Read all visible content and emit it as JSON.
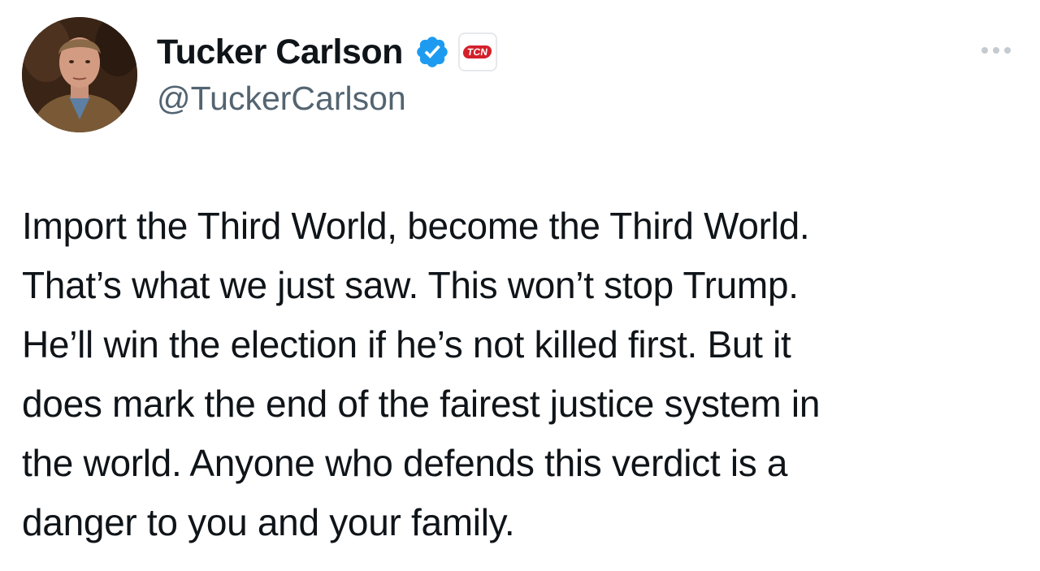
{
  "author": {
    "display_name": "Tucker Carlson",
    "handle": "@TuckerCarlson",
    "verified_icon": "verified-badge-icon",
    "affiliate_badge_text": "TCN",
    "colors": {
      "verified_blue": "#1d9bf0",
      "affiliate_red": "#d4202a",
      "name_text": "#0f1419",
      "handle_text": "#536471"
    }
  },
  "menu": {
    "icon": "more-horizontal-icon"
  },
  "tweet": {
    "lines": [
      "Import the Third World, become the Third World.",
      "That’s what we just saw. This won’t stop Trump.",
      "He’ll win the election if he’s not killed first. But it",
      "does mark the end of the fairest justice system in",
      "the world. Anyone who defends this verdict is a",
      "danger to you and your family."
    ]
  }
}
